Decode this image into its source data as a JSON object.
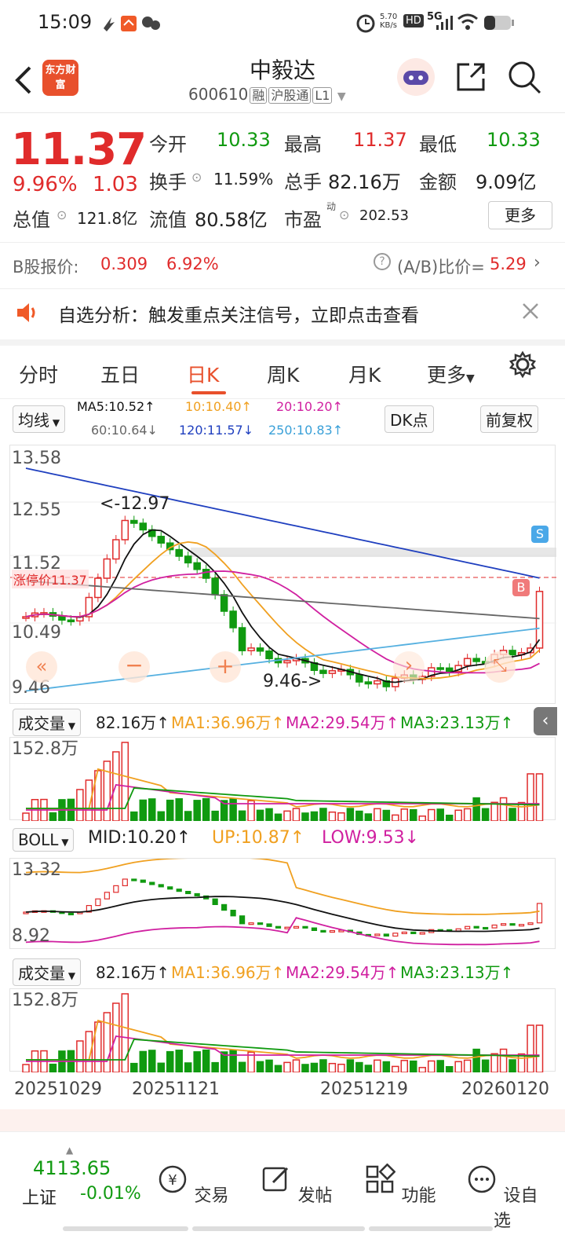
{
  "status": {
    "time": "15:09",
    "net": "5.70 KB/s",
    "hd": "HD",
    "sig": "5G"
  },
  "header": {
    "logo": "东方财富",
    "title": "中毅达",
    "code": "600610",
    "tags": [
      "融",
      "沪股通",
      "L1"
    ]
  },
  "quote": {
    "price": "11.37",
    "pct": "9.96%",
    "chg": "1.03",
    "open_label": "今开",
    "open": "10.33",
    "high_label": "最高",
    "high": "11.37",
    "low_label": "最低",
    "low": "10.33",
    "turnover_label": "换手",
    "turnover": "11.59%",
    "volume_label": "总手",
    "volume": "82.16万",
    "amount_label": "金额",
    "amount": "9.09亿",
    "mktcap_label": "总值",
    "mktcap": "121.8亿",
    "float_label": "流值",
    "float": "80.58亿",
    "pe_label": "市盈",
    "pe_sup": "动",
    "pe": "202.53",
    "more": "更多"
  },
  "bshare": {
    "label": "B股报价:",
    "price": "0.309",
    "pct": "6.92%",
    "ratio_label": "(A/B)比价=",
    "ratio": "5.29"
  },
  "notice": {
    "text": "自选分析：触发重点关注信号，立即点击查看"
  },
  "tabs": [
    "分时",
    "五日",
    "日K",
    "周K",
    "月K",
    "更多"
  ],
  "ma": {
    "selector": "均线",
    "ma5": "MA5:10.52↑",
    "ma10": "10:10.40↑",
    "ma20": "20:10.20↑",
    "ma60": "60:10.64↓",
    "ma120": "120:11.57↓",
    "ma250": "250:10.83↑",
    "dk": "DK点",
    "fq": "前复权"
  },
  "main_chart": {
    "y_labels": [
      "13.58",
      "12.55",
      "11.52",
      "10.49",
      "9.46"
    ],
    "high_mark": "<-12.97",
    "low_mark": "9.46->",
    "limit_tag": "涨停价11.37",
    "badge_s": "S",
    "badge_b": "B"
  },
  "vol1": {
    "selector": "成交量",
    "vol": "82.16万↑",
    "ma1": "MA1:36.96万↑",
    "ma2": "MA2:29.54万↑",
    "ma3": "MA3:23.13万↑",
    "ymax": "152.8万"
  },
  "boll": {
    "selector": "BOLL",
    "mid": "MID:10.20↑",
    "up": "UP:10.87↑",
    "low": "LOW:9.53↓",
    "ytop": "13.32",
    "ybot": "8.92"
  },
  "vol2": {
    "selector": "成交量",
    "vol": "82.16万↑",
    "ma1": "MA1:36.96万↑",
    "ma2": "MA2:29.54万↑",
    "ma3": "MA3:23.13万↑",
    "ymax": "152.8万"
  },
  "dates": [
    "20251029",
    "20251121",
    "20251219",
    "20260120"
  ],
  "bottom": {
    "index_value": "4113.65",
    "index_name": "上证",
    "index_pct": "-0.01%",
    "nav": [
      "交易",
      "发帖",
      "功能",
      "设自选"
    ]
  },
  "colors": {
    "red": "#e02b2b",
    "green": "#109a10",
    "ma5": "#111111",
    "ma10": "#f0a020",
    "ma20": "#d020a0",
    "ma60": "#666666",
    "ma120": "#1f3fbf",
    "ma250": "#55b0e0"
  }
}
